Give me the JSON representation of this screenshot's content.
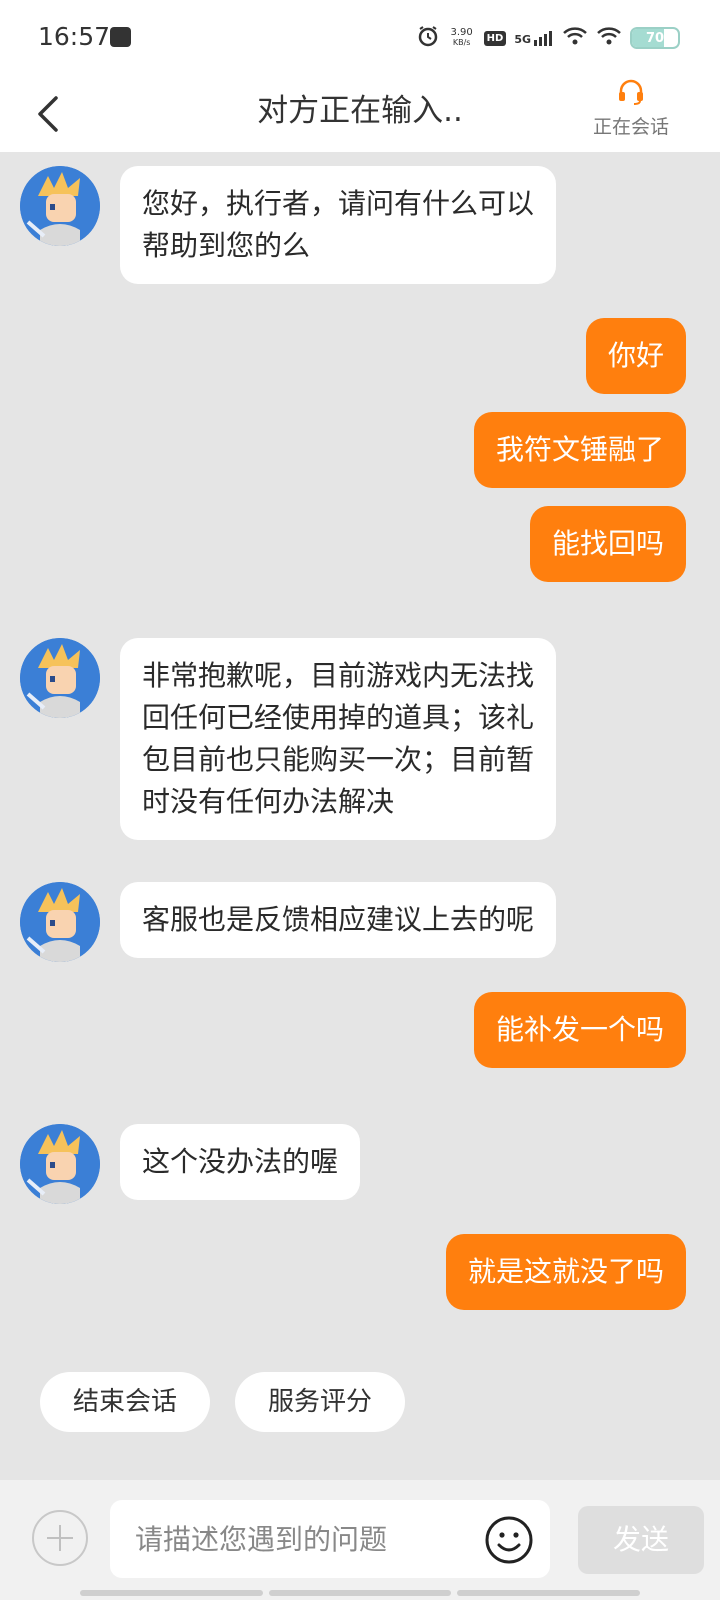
{
  "status_bar": {
    "time": "16:57",
    "net_speed_value": "3.90",
    "net_speed_unit": "KB/s",
    "hd_label": "HD",
    "network": "5G",
    "battery": "70"
  },
  "header": {
    "title": "对方正在输入..",
    "live_chat_label": "正在会话"
  },
  "messages": [
    {
      "from": "agent",
      "text": "您好，执行者，请问有什么可以\n帮助到您的么"
    },
    {
      "from": "user",
      "text": "你好"
    },
    {
      "from": "user",
      "text": "我符文锤融了"
    },
    {
      "from": "user",
      "text": "能找回吗"
    },
    {
      "from": "agent",
      "text": "非常抱歉呢，目前游戏内无法找\n回任何已经使用掉的道具；该礼\n包目前也只能购买一次；目前暂\n时没有任何办法解决"
    },
    {
      "from": "agent",
      "text": "客服也是反馈相应建议上去的呢"
    },
    {
      "from": "user",
      "text": "能补发一个吗"
    },
    {
      "from": "agent",
      "text": "这个没办法的喔"
    },
    {
      "from": "user",
      "text": "就是这就没了吗"
    }
  ],
  "quick_actions": {
    "end_chat": "结束会话",
    "rate_service": "服务评分"
  },
  "input": {
    "placeholder": "请描述您遇到的问题",
    "send_label": "发送"
  },
  "colors": {
    "accent": "#ff7f0e",
    "chat_background": "#e5e5e5"
  }
}
